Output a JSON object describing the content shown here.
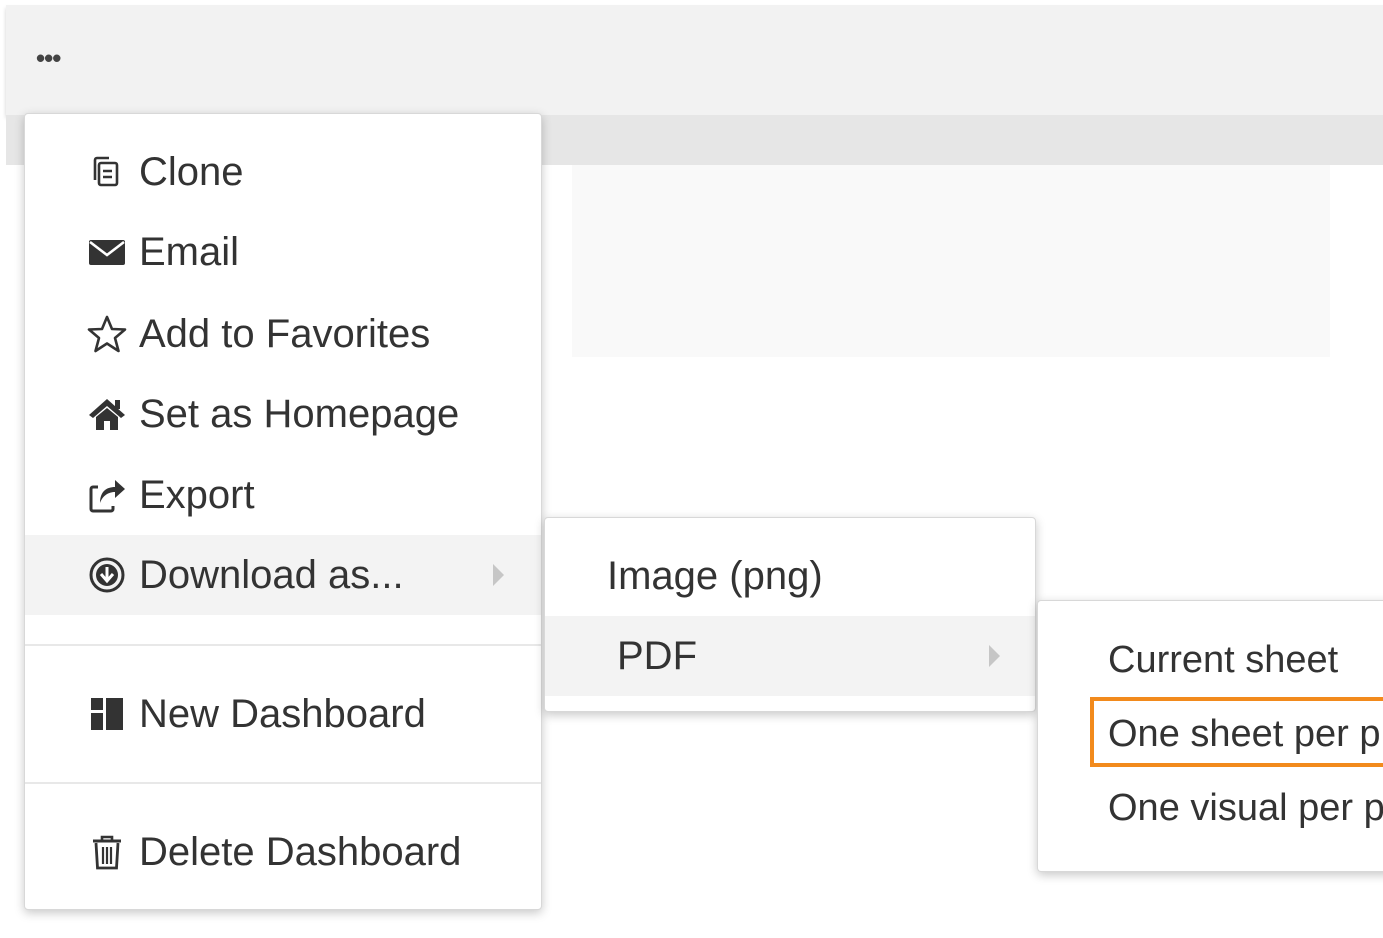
{
  "toolbar": {
    "more_label": "•••"
  },
  "main_menu": {
    "items": [
      {
        "label": "Clone",
        "icon": "clone-icon"
      },
      {
        "label": "Email",
        "icon": "envelope-icon"
      },
      {
        "label": "Add to Favorites",
        "icon": "star-icon"
      },
      {
        "label": "Set as Homepage",
        "icon": "home-icon"
      },
      {
        "label": "Export",
        "icon": "export-icon"
      },
      {
        "label": "Download as...",
        "icon": "download-icon",
        "has_submenu": true,
        "active": true
      },
      {
        "label": "New Dashboard",
        "icon": "dashboard-icon"
      },
      {
        "label": "Delete Dashboard",
        "icon": "trash-icon"
      }
    ]
  },
  "download_menu": {
    "items": [
      {
        "label": "Image (png)"
      },
      {
        "label": "PDF",
        "has_submenu": true,
        "active": true
      }
    ]
  },
  "pdf_menu": {
    "items": [
      {
        "label": "Current sheet"
      },
      {
        "label": "One sheet per p",
        "highlighted": true
      },
      {
        "label": "One visual per p"
      }
    ]
  },
  "colors": {
    "highlight": "#f28a1c",
    "active_row": "#f3f3f3",
    "topbar": "#f2f2f2"
  }
}
